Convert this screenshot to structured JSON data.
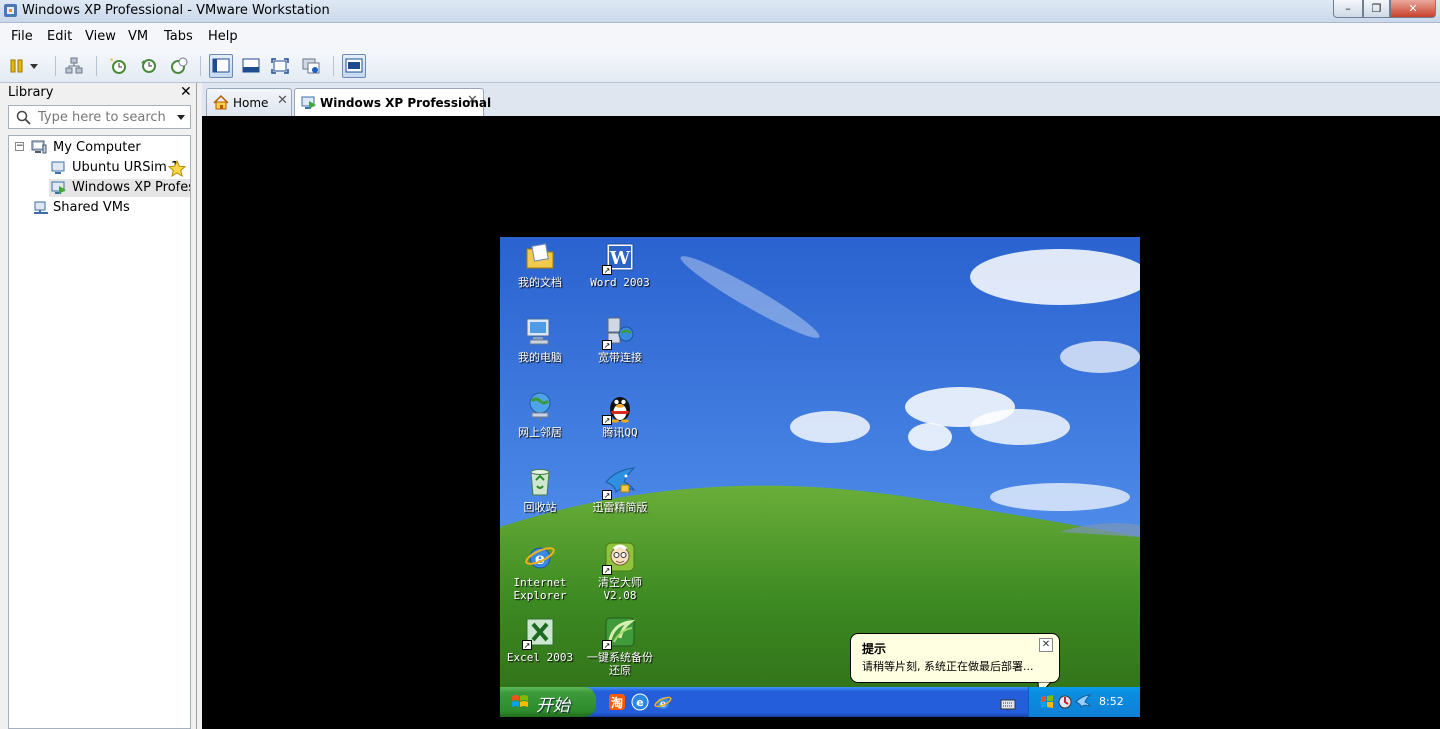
{
  "window": {
    "title": "Windows XP Professional - VMware Workstation",
    "controls": {
      "minimize": "–",
      "restore": "❐",
      "close": "✕"
    }
  },
  "menu": [
    "File",
    "Edit",
    "View",
    "VM",
    "Tabs",
    "Help"
  ],
  "toolbar": {
    "icons": [
      "pause-icon",
      "dropdown-arrow-icon",
      "send-ctrl-alt-del-icon",
      "snapshot-take-icon",
      "snapshot-revert-icon",
      "snapshot-manager-icon",
      "view-console-icon",
      "view-quick-switch-icon",
      "view-fullscreen-icon",
      "view-unity-icon",
      "view-library-toggle-icon"
    ]
  },
  "library": {
    "title": "Library",
    "close": "✕",
    "search_placeholder": "Type here to search",
    "tree": {
      "my_computer": "My Computer",
      "items": [
        "Ubuntu URSim 1",
        "Windows XP Profess"
      ],
      "shared": "Shared VMs"
    }
  },
  "tabs": [
    {
      "label": "Home",
      "close": "✕"
    },
    {
      "label": "Windows XP Professional",
      "close": "✕"
    }
  ],
  "guest": {
    "desktop_icons": [
      {
        "label": "我的文档",
        "label2": ""
      },
      {
        "label": "Word 2003",
        "label2": ""
      },
      {
        "label": "我的电脑",
        "label2": ""
      },
      {
        "label": "宽带连接",
        "label2": ""
      },
      {
        "label": "网上邻居",
        "label2": ""
      },
      {
        "label": "腾讯QQ",
        "label2": ""
      },
      {
        "label": "回收站",
        "label2": ""
      },
      {
        "label": "迅雷精简版",
        "label2": ""
      },
      {
        "label": "Internet",
        "label2": "Explorer"
      },
      {
        "label": "清空大师",
        "label2": "V2.08"
      },
      {
        "label": "Excel 2003",
        "label2": ""
      },
      {
        "label": "一键系统备份",
        "label2": "还原"
      }
    ],
    "start_label": "开始",
    "quicklaunch_icons": [
      "taobao-icon",
      "qq-browser-icon",
      "internet-explorer-icon"
    ],
    "clock": "8:52",
    "balloon": {
      "title": "提示",
      "text": "请稍等片刻, 系统正在做最后部署...",
      "close": "✕"
    }
  },
  "colors": {
    "accent": "#245edb",
    "sky": "#3f7ee6",
    "grass": "#4f9a2e"
  }
}
